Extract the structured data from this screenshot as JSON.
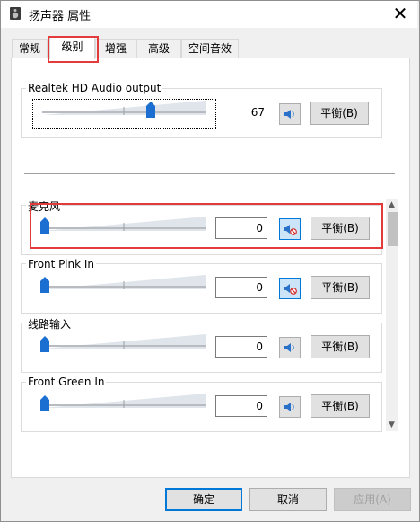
{
  "window": {
    "title": "扬声器 属性",
    "close_glyph": "✕"
  },
  "tabs": [
    {
      "label": "常规"
    },
    {
      "label": "级别"
    },
    {
      "label": "增强"
    },
    {
      "label": "高级"
    },
    {
      "label": "空间音效"
    }
  ],
  "active_tab": "级别",
  "output": {
    "label": "Realtek HD Audio output",
    "level": "67",
    "level_fraction": 0.67,
    "muted": false,
    "balance_label": "平衡(B)"
  },
  "devices": [
    {
      "label": "麦克风",
      "level": "0",
      "level_fraction": 0.0,
      "muted": true,
      "balance_label": "平衡(B)"
    },
    {
      "label": "Front Pink In",
      "level": "0",
      "level_fraction": 0.0,
      "muted": true,
      "balance_label": "平衡(B)"
    },
    {
      "label": "线路输入",
      "level": "0",
      "level_fraction": 0.0,
      "muted": false,
      "balance_label": "平衡(B)"
    },
    {
      "label": "Front Green In",
      "level": "0",
      "level_fraction": 0.0,
      "muted": false,
      "balance_label": "平衡(B)"
    }
  ],
  "footer": {
    "ok_label": "确定",
    "cancel_label": "取消",
    "apply_label": "应用(A)"
  },
  "icons": {
    "speaker": "speaker-icon",
    "speaker_muted": "speaker-muted-icon"
  },
  "colors": {
    "highlight_red": "#e33b3b",
    "thumb_blue": "#1a6fd1",
    "focus_blue": "#0078d7"
  }
}
